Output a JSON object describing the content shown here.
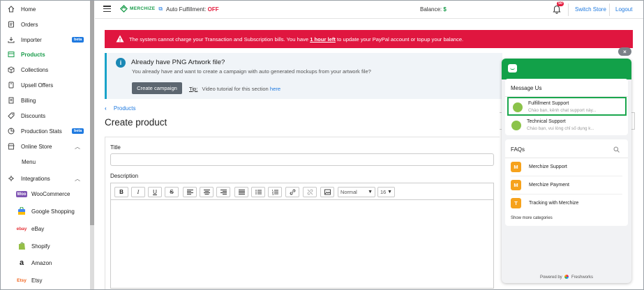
{
  "sidebar": {
    "items": [
      {
        "label": "Home",
        "icon": "home-icon"
      },
      {
        "label": "Orders",
        "icon": "orders-icon"
      },
      {
        "label": "Importer",
        "icon": "import-icon",
        "badge": "beta"
      },
      {
        "label": "Products",
        "icon": "products-icon",
        "active": true
      },
      {
        "label": "Collections",
        "icon": "collections-icon"
      },
      {
        "label": "Upsell Offers",
        "icon": "upsell-icon"
      },
      {
        "label": "Billing",
        "icon": "billing-icon"
      },
      {
        "label": "Discounts",
        "icon": "discount-tag-icon"
      },
      {
        "label": "Production Stats",
        "icon": "stats-icon",
        "badge": "beta"
      },
      {
        "label": "Online Store",
        "icon": "store-icon"
      },
      {
        "label": "Menu"
      },
      {
        "label": "Integrations",
        "icon": "integrations-icon"
      }
    ],
    "platforms": [
      {
        "label": "WooCommerce",
        "logo_text": "Woo"
      },
      {
        "label": "Google Shopping"
      },
      {
        "label": "eBay",
        "logo_text": "ebay"
      },
      {
        "label": "Shopify"
      },
      {
        "label": "Amazon",
        "logo_text": "a"
      },
      {
        "label": "Etsy",
        "logo_text": "Etsy"
      }
    ]
  },
  "topbar": {
    "brand": "MERCHIZE",
    "auto_fulfillment_label": "Auto Fulfillment:",
    "auto_fulfillment_status": "OFF",
    "balance_label": "Balance:",
    "balance_value": "$",
    "notification_count": "50",
    "switch_store": "Switch Store",
    "logout": "Logout"
  },
  "alert": {
    "text_before": "The system cannot charge your Transaction and Subscription bills. You have",
    "highlight": "1 hour left",
    "text_after": "to update your PayPal account or topup your balance."
  },
  "banner": {
    "title": "Already have PNG Artwork file?",
    "subtitle": "You already have and want to create a campaign with auto generated mockups from your artwork file?",
    "button": "Create campaign",
    "tip_label": "Tip:",
    "tip_text": "Video tutorial for this section",
    "tip_link": "here"
  },
  "content": {
    "breadcrumb": "Products",
    "page_title": "Create product",
    "title_label": "Title",
    "title_value": "",
    "description_label": "Description",
    "toolbar": {
      "bold": "B",
      "italic": "I",
      "underline": "U",
      "strike": "S",
      "format": "Normal",
      "size": "16"
    }
  },
  "chat": {
    "close": "×",
    "message_us": "Message Us",
    "conversations": [
      {
        "name": "Fulfillment Support",
        "preview": "Chào bạn, kênh chat support này...",
        "selected": true
      },
      {
        "name": "Technical Support",
        "preview": "Chào bạn, vui lòng chỉ số dụng k..."
      }
    ],
    "faqs_title": "FAQs",
    "faqs": [
      {
        "letter": "M",
        "label": "Merchize Support"
      },
      {
        "letter": "M",
        "label": "Merchize Payment"
      },
      {
        "letter": "T",
        "label": "Tracking with Merchize"
      }
    ],
    "show_more": "Show more categories",
    "powered_by": "Powered by",
    "powered_brand": "Freshworks"
  },
  "colors": {
    "brand_green": "#1a9c4b",
    "alert_red": "#e0163f",
    "link_blue": "#1f7ae0",
    "chat_green": "#12a149"
  }
}
